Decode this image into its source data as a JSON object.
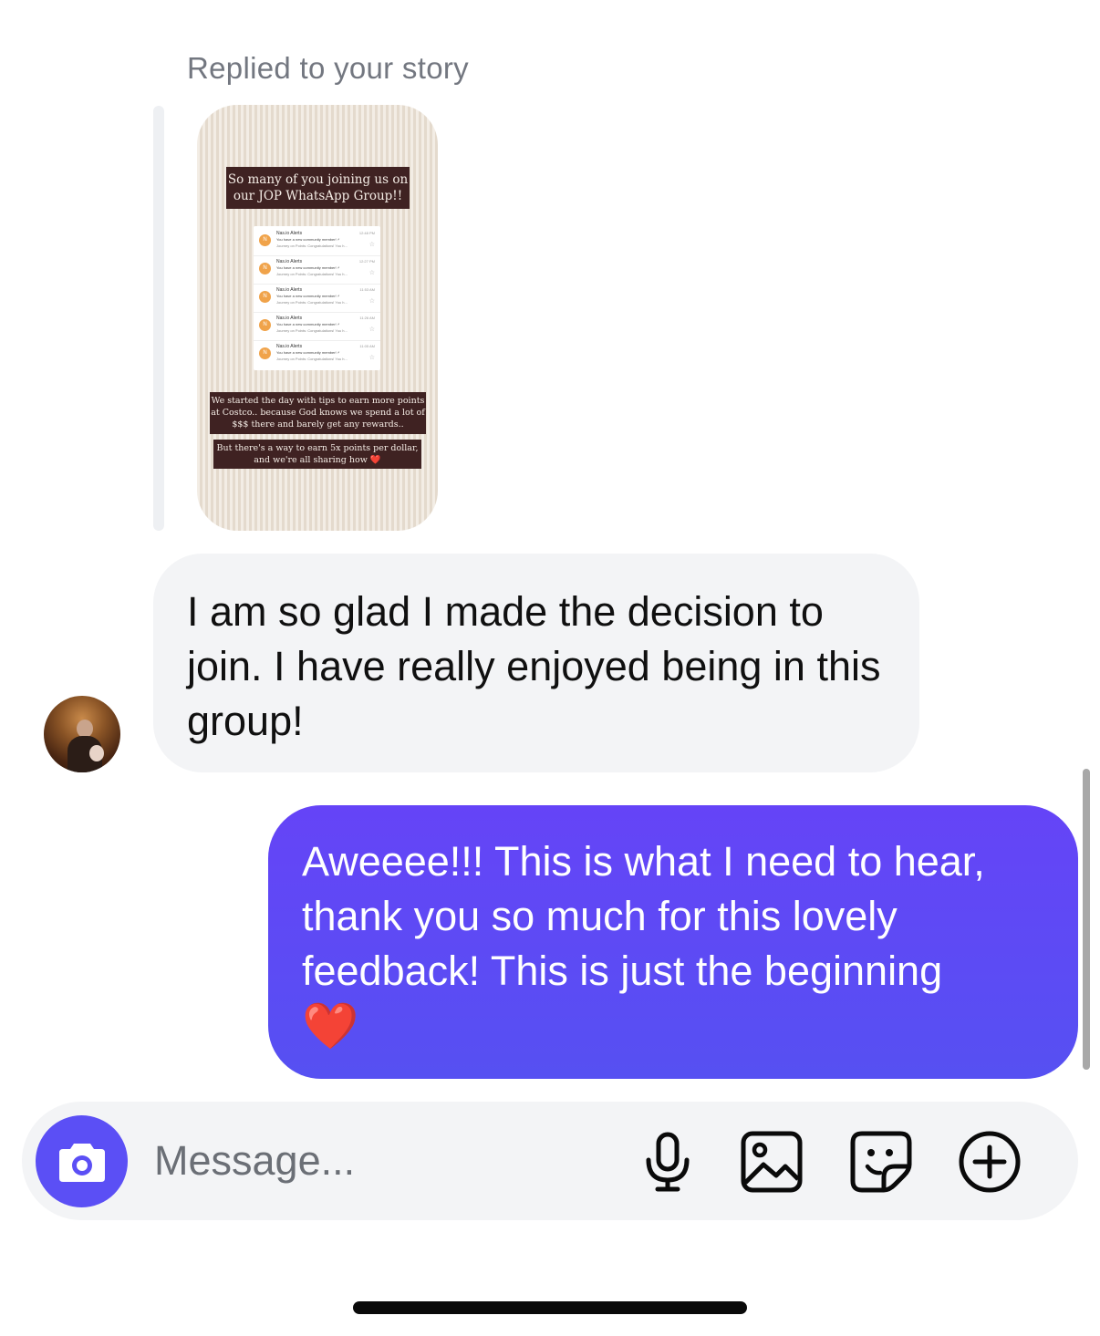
{
  "reply": {
    "label": "Replied to your story"
  },
  "story": {
    "caption1": "So many of you joining us on our JOP WhatsApp Group!!",
    "caption2": "We started the day with tips to earn more points at Costco.. because God knows we spend a lot of $$$ there and barely get any rewards..",
    "caption3": "But there's a way to earn 5x points per dollar, and we're all sharing how",
    "caption3_heart": "❤️",
    "notifications": [
      {
        "avatar": "N",
        "title": "Nas.io Alerts",
        "time": "12:48 PM",
        "line1": "You have a new community member! ⚡",
        "line2": "Journey on Points: Congratulations! You h..."
      },
      {
        "avatar": "N",
        "title": "Nas.io Alerts",
        "time": "12:27 PM",
        "line1": "You have a new community member! ⚡",
        "line2": "Journey on Points: Congratulations! You h..."
      },
      {
        "avatar": "N",
        "title": "Nas.io Alerts",
        "time": "11:53 AM",
        "line1": "You have a new community member! ⚡",
        "line2": "Journey on Points: Congratulations! You h..."
      },
      {
        "avatar": "N",
        "title": "Nas.io Alerts",
        "time": "11:26 AM",
        "line1": "You have a new community member! ⚡",
        "line2": "Journey on Points: Congratulations! You h..."
      },
      {
        "avatar": "N",
        "title": "Nas.io Alerts",
        "time": "11:05 AM",
        "line1": "You have a new community member! ⚡",
        "line2": "Journey on Points: Congratulations! You h..."
      }
    ]
  },
  "messages": {
    "incoming": "I am so glad I made the decision to join. I have really enjoyed being in this group!",
    "outgoing": "Aweeee!!! This is what I need to hear, thank you so much for this lovely feedback! This is just the beginning",
    "outgoing_emoji": "❤️"
  },
  "composer": {
    "placeholder": "Message..."
  },
  "icons": {
    "camera": "camera-icon",
    "mic": "microphone-icon",
    "gallery": "gallery-icon",
    "sticker": "sticker-icon",
    "more": "plus-circle-icon"
  },
  "colors": {
    "accent": "#5b4ff5",
    "outgoing_bubble_top": "#6544f7",
    "outgoing_bubble_bottom": "#5650f2",
    "incoming_bubble": "#f3f4f6"
  }
}
